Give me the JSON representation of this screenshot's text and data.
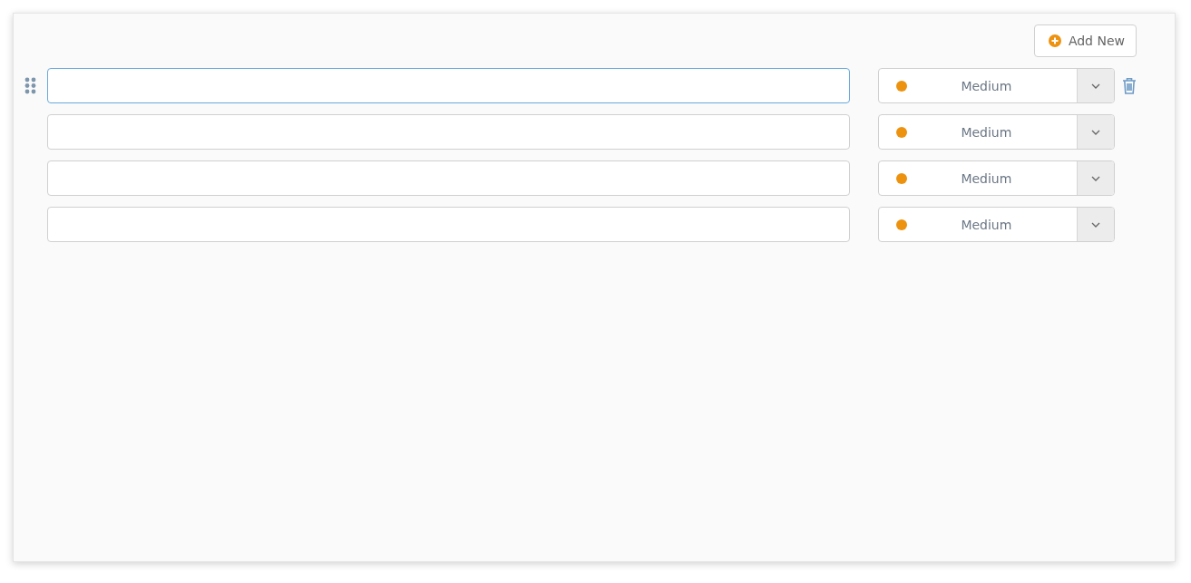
{
  "add_button": {
    "label": "Add New"
  },
  "rows": [
    {
      "focused": true,
      "priority": {
        "label": "Medium",
        "color": "#ec920f"
      }
    },
    {
      "focused": false,
      "priority": {
        "label": "Medium",
        "color": "#ec920f"
      }
    },
    {
      "focused": false,
      "priority": {
        "label": "Medium",
        "color": "#ec920f"
      }
    },
    {
      "focused": false,
      "priority": {
        "label": "Medium",
        "color": "#ec920f"
      }
    }
  ]
}
